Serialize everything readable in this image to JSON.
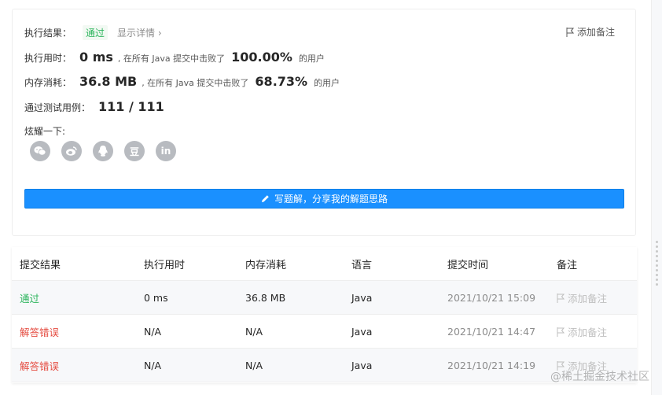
{
  "result": {
    "label_result": "执行结果：",
    "status": "通过",
    "show_details": "显示详情 ›",
    "add_note": "添加备注",
    "runtime_label": "执行用时：",
    "runtime_value": "0 ms",
    "beat_text": ", 在所有 Java 提交中击败了",
    "runtime_pct": "100.00%",
    "users_text": "的用户",
    "memory_label": "内存消耗：",
    "memory_value": "36.8 MB",
    "memory_pct": "68.73%",
    "tests_label": "通过测试用例：",
    "tests_value": "111 / 111",
    "share_label": "炫耀一下:",
    "share_icons": [
      "wechat-icon",
      "weibo-icon",
      "qq-icon",
      "douban-icon",
      "linkedin-icon"
    ],
    "share_douban_glyph": "豆",
    "share_linkedin_glyph": "in",
    "write_solution": "写题解，分享我的解题思路"
  },
  "table": {
    "headers": [
      "提交结果",
      "执行用时",
      "内存消耗",
      "语言",
      "提交时间",
      "备注"
    ],
    "rows": [
      {
        "result": "通过",
        "runtime": "0 ms",
        "memory": "36.8 MB",
        "language": "Java",
        "time": "2021/10/21 15:09",
        "note": "添加备注"
      },
      {
        "result": "解答错误",
        "runtime": "N/A",
        "memory": "N/A",
        "language": "Java",
        "time": "2021/10/21 14:47",
        "note": "添加备注"
      },
      {
        "result": "解答错误",
        "runtime": "N/A",
        "memory": "N/A",
        "language": "Java",
        "time": "2021/10/21 14:19",
        "note": "添加备注"
      }
    ]
  },
  "watermark": "@稀土掘金技术社区",
  "colors": {
    "accent": "#1a90ff",
    "pass": "#2db55d",
    "fail": "#e54d42"
  }
}
